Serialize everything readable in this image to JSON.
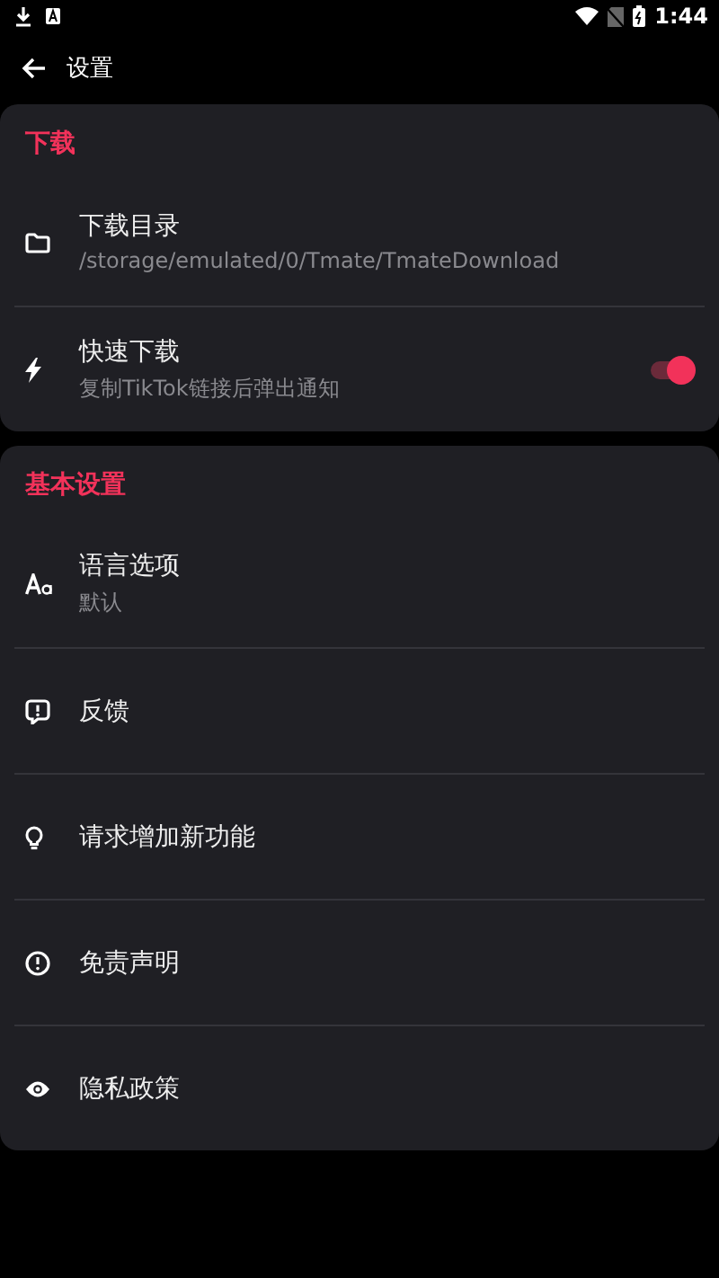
{
  "status_bar": {
    "time": "1:44"
  },
  "app_bar": {
    "title": "设置"
  },
  "sections": [
    {
      "title": "下载",
      "items": [
        {
          "kind": "nav",
          "label": "下载目录",
          "subtitle": "/storage/emulated/0/Tmate/TmateDownload"
        },
        {
          "kind": "toggle",
          "label": "快速下载",
          "subtitle": "复制TikTok链接后弹出通知",
          "on": true
        }
      ]
    },
    {
      "title": "基本设置",
      "items": [
        {
          "kind": "nav",
          "label": "语言选项",
          "subtitle": "默认"
        },
        {
          "kind": "nav",
          "label": "反馈"
        },
        {
          "kind": "nav",
          "label": "请求增加新功能"
        },
        {
          "kind": "nav",
          "label": "免责声明"
        },
        {
          "kind": "nav",
          "label": "隐私政策"
        }
      ]
    }
  ]
}
